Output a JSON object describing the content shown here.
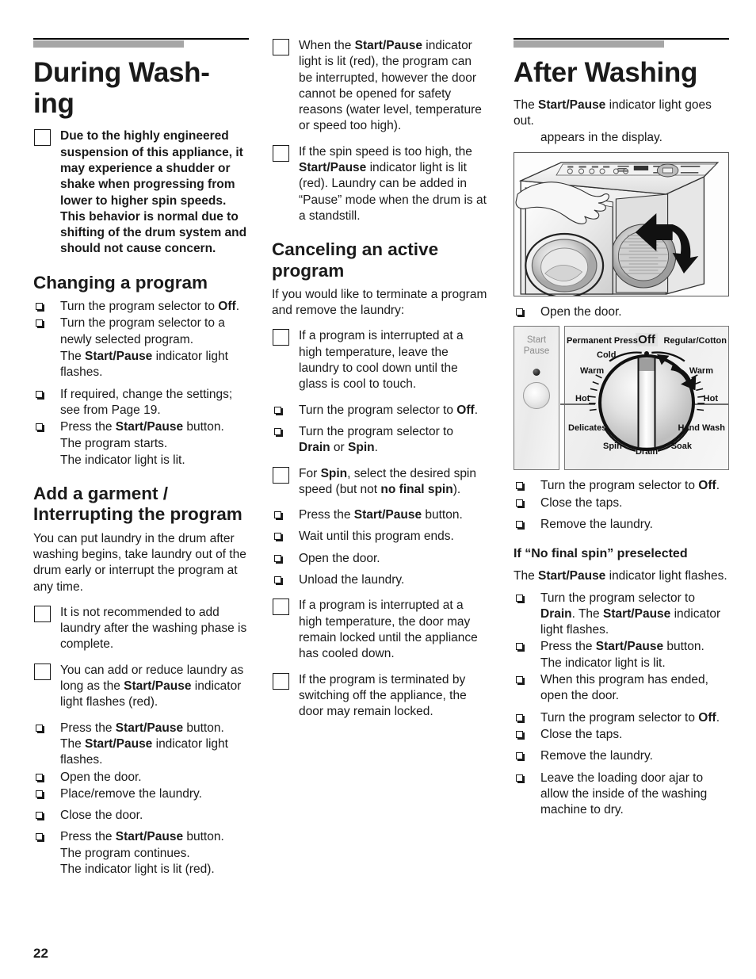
{
  "page": {
    "number": "22"
  },
  "col1": {
    "title": "During Wash-\ning",
    "note_1": {
      "text_parts": [
        {
          "t": "Due to the highly engineered suspension of this appliance, it may experience a shudder or shake when progressing from lower to higher spin speeds. This behavior is normal due to shifting of the drum system and should not cause concern.",
          "b": false
        }
      ]
    },
    "heading_changing": "Changing a program",
    "items": [
      {
        "pre": "Turn the program selector to ",
        "bold": "Off",
        "post": "."
      },
      {
        "pre": "Turn the program selector to a newly selected program.",
        "bold": "",
        "post": ""
      },
      {
        "pre": "If required, change the settings; see from Page 19.",
        "bold": "",
        "post": ""
      },
      {
        "pre": "Press the ",
        "bold": "Start/Pause",
        "post": " button."
      }
    ],
    "sub_line_after_item2_a": "The ",
    "sub_line_after_item2_b": "Start/Pause",
    "sub_line_after_item2_c": " indicator light flashes.",
    "sub_line_after_item4_a": "The program starts.",
    "sub_line_after_item4_b": "The indicator light is lit.",
    "heading_add_garment": "Add a garment / Interrupting the program",
    "para_add": "You can put laundry in the drum after washing begins, take laundry out of the drum early or interrupt the program at any time.",
    "note_2": "It is not recommended to add laundry after the washing phase is complete.",
    "note_3_a": "You can add or reduce laundry as long as the ",
    "note_3_b": "Start/Pause",
    "note_3_c": " indicator light flashes (red).",
    "items2_1_a": "Press the ",
    "items2_1_b": "Start/Pause",
    "items2_1_c": " button.",
    "items2_1_d": "The ",
    "items2_1_e": "Start/Pause",
    "items2_1_f": " indicator light flashes.",
    "items2_2": "Open the door.",
    "items2_3": "Place/remove the laundry.",
    "items2_4": "Close the door.",
    "items2_5_a": "Press the ",
    "items2_5_b": "Start/Pause",
    "items2_5_c": " button.",
    "items2_5_d": "The program continues.",
    "items2_5_e": "The indicator light is lit (red)."
  },
  "col2": {
    "note_1_a": "When the ",
    "note_1_b": "Start/Pause",
    "note_1_c": " indicator light is lit (red), the program can be interrupted, however the door cannot be opened for safety reasons (water level, temperature or speed too high).",
    "note_2_a": "If the spin speed is too high, the ",
    "note_2_b": "Start/Pause",
    "note_2_c": " indicator light is lit (red). Laundry can be added in “Pause” mode when the drum is at a standstill.",
    "heading_canceling": "Canceling an active program",
    "para_intro": "If you would like to terminate a program and remove the laundry:",
    "note_3": "If a program is interrupted at a high temperature, leave the laundry to cool down until the glass is cool to touch.",
    "item_1_a": "Turn the program selector to ",
    "item_1_b": "Off",
    "item_1_c": ".",
    "item_2_a": "Turn the program selector to ",
    "item_2_b": "Drain",
    "item_2_c": " or ",
    "item_2_d": "Spin",
    "item_2_e": ".",
    "note_4_a": "For ",
    "note_4_b": "Spin",
    "note_4_c": ", select the desired spin speed (but not ",
    "note_4_d": "no final spin",
    "note_4_e": ").",
    "item_3_a": "Press the ",
    "item_3_b": "Start/Pause",
    "item_3_c": " button.",
    "item_4": "Wait until this program ends.",
    "item_5": "Open the door.",
    "item_6": "Unload the laundry.",
    "note_5": "If a program is interrupted at a high temperature, the door may remain locked until the appliance has cooled down.",
    "note_6": "If the program is terminated by switching off the appliance, the door may remain locked."
  },
  "col3": {
    "title": "After Washing",
    "para_a": "The ",
    "para_b": "Start/Pause",
    "para_c": " indicator light goes out.",
    "para_display": "appears in the display.",
    "item_open_door": "Open the door.",
    "dial": {
      "start_pause_line1": "Start",
      "start_pause_line2": "Pause",
      "off": "Off",
      "permanent_press": "Permanent Press",
      "regular_cotton": "Regular/Cotton",
      "cold": "Cold",
      "warm_left": "Warm",
      "warm_right": "Warm",
      "hot_left": "Hot",
      "hot_right": "Hot",
      "delicates": "Delicates",
      "hand_wash": "Hand Wash",
      "spin": "Spin",
      "drain": "Drain",
      "soak": "Soak"
    },
    "item_1_a": "Turn the program selector to ",
    "item_1_b": "Off",
    "item_1_c": ".",
    "item_2": "Close the taps.",
    "item_3": "Remove the laundry.",
    "heading_no_final_spin": "If “No final spin” preselected",
    "para2_a": "The ",
    "para2_b": "Start/Pause",
    "para2_c": " indicator light flashes.",
    "item_4_a": "Turn the program selector to ",
    "item_4_b": "Drain",
    "item_4_c": ". The ",
    "item_4_d": "Start/Pause",
    "item_4_e": " indicator light flashes.",
    "item_5_a": "Press the ",
    "item_5_b": "Start/Pause",
    "item_5_c": " button.",
    "item_5_d": "The indicator light is lit.",
    "item_6": "When this program has ended, open the door.",
    "item_7_a": "Turn the program selector to ",
    "item_7_b": "Off",
    "item_7_c": ".",
    "item_8": "Close the taps.",
    "item_9": "Remove the laundry.",
    "item_10": "Leave the loading door ajar to allow the inside of the washing machine to dry."
  }
}
